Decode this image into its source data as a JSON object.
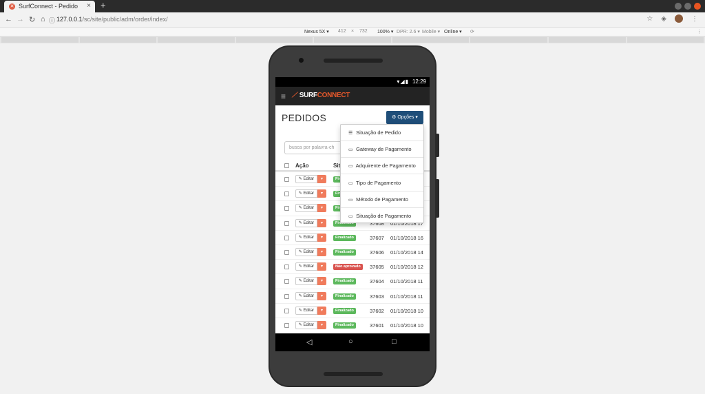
{
  "browser": {
    "tab_title": "SurfConnect - Pedido",
    "tab_close": "×",
    "new_tab": "+",
    "url_host": "127.0.0.1",
    "url_path": "/sc/site/public/adm/order/index/"
  },
  "devtools": {
    "device": "Nexus 5X ▾",
    "width": "412",
    "times": "×",
    "height": "732",
    "zoom": "100% ▾",
    "dpr": "DPR: 2.6 ▾",
    "mode": "Mobile ▾",
    "network": "Online ▾"
  },
  "status": {
    "time": "12:29"
  },
  "app": {
    "logo_left": "SURF",
    "logo_right": "CONNECT",
    "page_title": "PEDIDOS",
    "options_label": "Opções ▾",
    "search_placeholder": "busca por palavra-ch"
  },
  "table": {
    "col_action": "Ação",
    "col_status": "Sit",
    "edit_label": "Editar",
    "rows": [
      {
        "status": "Finalizado",
        "status_type": "ok",
        "id": "",
        "date": ""
      },
      {
        "status": "Finalizado",
        "status_type": "ok",
        "id": "",
        "date": ""
      },
      {
        "status": "Finalizado",
        "status_type": "ok",
        "id": "",
        "date": ""
      },
      {
        "status": "Finalizado",
        "status_type": "ok",
        "id": "37608",
        "date": "01/10/2018 17"
      },
      {
        "status": "Finalizado",
        "status_type": "ok",
        "id": "37607",
        "date": "01/10/2018 16"
      },
      {
        "status": "Finalizado",
        "status_type": "ok",
        "id": "37606",
        "date": "01/10/2018 14"
      },
      {
        "status": "Não aprovado",
        "status_type": "bad",
        "id": "37605",
        "date": "01/10/2018 12"
      },
      {
        "status": "Finalizado",
        "status_type": "ok",
        "id": "37604",
        "date": "01/10/2018 11"
      },
      {
        "status": "Finalizado",
        "status_type": "ok",
        "id": "37603",
        "date": "01/10/2018 11"
      },
      {
        "status": "Finalizado",
        "status_type": "ok",
        "id": "37602",
        "date": "01/10/2018 10"
      },
      {
        "status": "Finalizado",
        "status_type": "ok",
        "id": "37601",
        "date": "01/10/2018 10"
      }
    ]
  },
  "dropdown": {
    "items": [
      {
        "label": "Situação de Pedido",
        "icon": "list-icon"
      },
      {
        "label": "Gateway de Pagamento",
        "icon": "credit-card-icon"
      },
      {
        "label": "Adquirente de Pagamento",
        "icon": "credit-card-icon"
      },
      {
        "label": "Tipo de Pagamento",
        "icon": "credit-card-icon"
      },
      {
        "label": "Método de Pagamento",
        "icon": "credit-card-icon"
      },
      {
        "label": "Situação de Pagamento",
        "icon": "credit-card-icon"
      }
    ]
  },
  "colors": {
    "primary": "#1f4e79",
    "accent": "#e6582b",
    "success": "#5cb85c",
    "danger": "#d9534f",
    "caret": "#f07b5c"
  }
}
